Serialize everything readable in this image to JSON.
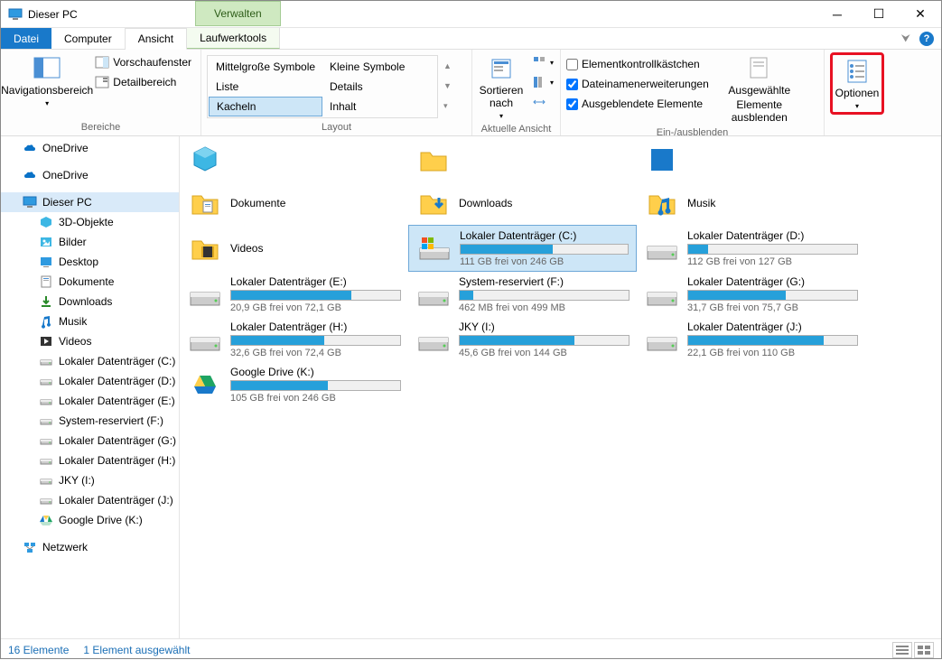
{
  "window": {
    "title": "Dieser PC"
  },
  "titlebar": {
    "manage": "Verwalten",
    "min": "—",
    "max": "☐",
    "close": "✕"
  },
  "tabs": {
    "datei": "Datei",
    "computer": "Computer",
    "ansicht": "Ansicht",
    "tools": "Laufwerktools"
  },
  "ribbon": {
    "bereiche": {
      "label": "Bereiche",
      "nav": "Navigationsbereich",
      "preview": "Vorschaufenster",
      "detail": "Detailbereich"
    },
    "layout": {
      "label": "Layout",
      "items": [
        "Mittelgroße Symbole",
        "Kleine Symbole",
        "Liste",
        "Details",
        "Kacheln",
        "Inhalt"
      ]
    },
    "currentview": {
      "label": "Aktuelle Ansicht",
      "sort": "Sortieren nach"
    },
    "showhide": {
      "label": "Ein-/ausblenden",
      "checkbox1": "Elementkontrollkästchen",
      "checkbox2": "Dateinamenerweiterungen",
      "checkbox3": "Ausgeblendete Elemente",
      "hidebtn_line1": "Ausgewählte",
      "hidebtn_line2": "Elemente ausblenden"
    },
    "options": {
      "label": "Optionen"
    }
  },
  "sidebar": {
    "onedrive1": "OneDrive",
    "onedrive2": "OneDrive",
    "thispc": "Dieser PC",
    "children": [
      "3D-Objekte",
      "Bilder",
      "Desktop",
      "Dokumente",
      "Downloads",
      "Musik",
      "Videos",
      "Lokaler Datenträger (C:)",
      "Lokaler Datenträger (D:)",
      "Lokaler Datenträger (E:)",
      "System-reserviert (F:)",
      "Lokaler Datenträger (G:)",
      "Lokaler Datenträger (H:)",
      "JKY (I:)",
      "Lokaler Datenträger (J:)",
      "Google Drive (K:)"
    ],
    "network": "Netzwerk"
  },
  "folders": [
    {
      "label": "Dokumente",
      "icon": "doc"
    },
    {
      "label": "Downloads",
      "icon": "dl"
    },
    {
      "label": "Musik",
      "icon": "music"
    },
    {
      "label": "Videos",
      "icon": "video"
    }
  ],
  "topfolder": {
    "label": "",
    "icon": "cube"
  },
  "drives": [
    {
      "name": "Lokaler Datenträger (C:)",
      "free": "111 GB frei von 246 GB",
      "pct": 55,
      "selected": true,
      "icon": "win"
    },
    {
      "name": "Lokaler Datenträger (D:)",
      "free": "112 GB frei von 127 GB",
      "pct": 12,
      "icon": "hdd"
    },
    {
      "name": "Lokaler Datenträger (E:)",
      "free": "20,9 GB frei von 72,1 GB",
      "pct": 71,
      "icon": "hdd"
    },
    {
      "name": "System-reserviert (F:)",
      "free": "462 MB frei von 499 MB",
      "pct": 8,
      "icon": "hdd"
    },
    {
      "name": "Lokaler Datenträger (G:)",
      "free": "31,7 GB frei von 75,7 GB",
      "pct": 58,
      "icon": "hdd"
    },
    {
      "name": "Lokaler Datenträger (H:)",
      "free": "32,6 GB frei von 72,4 GB",
      "pct": 55,
      "icon": "hdd"
    },
    {
      "name": "JKY (I:)",
      "free": "45,6 GB frei von 144 GB",
      "pct": 68,
      "icon": "hdd"
    },
    {
      "name": "Lokaler Datenträger (J:)",
      "free": "22,1 GB frei von 110 GB",
      "pct": 80,
      "icon": "hdd"
    },
    {
      "name": "Google Drive (K:)",
      "free": "105 GB frei von 246 GB",
      "pct": 57,
      "icon": "gdrive"
    }
  ],
  "status": {
    "count": "16 Elemente",
    "selected": "1 Element ausgewählt"
  }
}
